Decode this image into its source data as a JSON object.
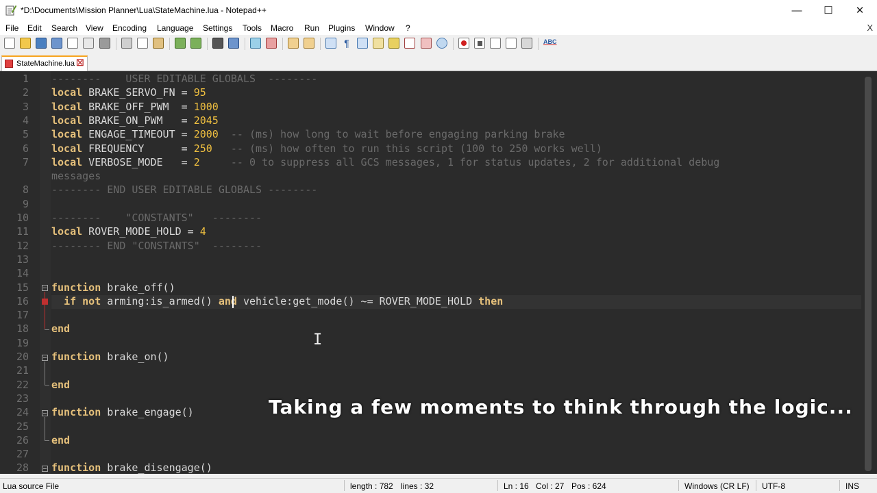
{
  "window": {
    "title": "*D:\\Documents\\Mission Planner\\Lua\\StateMachine.lua - Notepad++"
  },
  "window_controls": {
    "minimize": "—",
    "maximize": "☐",
    "close": "✕"
  },
  "menu": [
    "File",
    "Edit",
    "Search",
    "View",
    "Encoding",
    "Language",
    "Settings",
    "Tools",
    "Macro",
    "Run",
    "Plugins",
    "Window",
    "?"
  ],
  "menu_close": "X",
  "tab": {
    "label": "StateMachine.lua",
    "close": "☒"
  },
  "editor": {
    "line_numbers": [
      "1",
      "2",
      "3",
      "4",
      "5",
      "6",
      "7",
      "",
      "8",
      "9",
      "10",
      "11",
      "12",
      "13",
      "14",
      "15",
      "16",
      "17",
      "18",
      "19",
      "20",
      "21",
      "22",
      "23",
      "24",
      "25",
      "26",
      "27",
      "28"
    ],
    "lines": [
      {
        "cm": "--------    USER EDITABLE GLOBALS  --------"
      },
      {
        "kw": "local",
        "text": " BRAKE_SERVO_FN = ",
        "num": "95"
      },
      {
        "kw": "local",
        "text": " BRAKE_OFF_PWM  = ",
        "num": "1000"
      },
      {
        "kw": "local",
        "text": " BRAKE_ON_PWM   = ",
        "num": "2045"
      },
      {
        "kw": "local",
        "text": " ENGAGE_TIMEOUT = ",
        "num": "2000",
        "cm": "  -- (ms) how long to wait before engaging parking brake"
      },
      {
        "kw": "local",
        "text": " FREQUENCY      = ",
        "num": "250",
        "cm": "   -- (ms) how often to run this script (100 to 250 works well)"
      },
      {
        "kw": "local",
        "text": " VERBOSE_MODE   = ",
        "num": "2",
        "cm": "     -- 0 to suppress all GCS messages, 1 for status updates, 2 for additional debug"
      },
      {
        "cm": "messages"
      },
      {
        "cm": "-------- END USER EDITABLE GLOBALS --------"
      },
      {
        "text": ""
      },
      {
        "cm": "--------    \"CONSTANTS\"   --------"
      },
      {
        "kw": "local",
        "text": " ROVER_MODE_HOLD = ",
        "num": "4"
      },
      {
        "cm": "-------- END \"CONSTANTS\"  --------"
      },
      {
        "text": ""
      },
      {
        "text": ""
      },
      {
        "kw": "function",
        "text": " brake_off()"
      },
      {
        "pre": "  ",
        "kw": "if not",
        "text": " arming:is_armed() ",
        "kw2": "and",
        "text2": " vehicle:get_mode() ~= ROVER_MODE_HOLD ",
        "kw3": "then"
      },
      {
        "text": ""
      },
      {
        "kw": "end"
      },
      {
        "text": ""
      },
      {
        "kw": "function",
        "text": " brake_on()"
      },
      {
        "text": ""
      },
      {
        "kw": "end"
      },
      {
        "text": ""
      },
      {
        "kw": "function",
        "text": " brake_engage()"
      },
      {
        "text": ""
      },
      {
        "kw": "end"
      },
      {
        "text": ""
      },
      {
        "kw": "function",
        "text": " brake_disengage()"
      }
    ]
  },
  "overlay_caption": "Taking a few moments to think through the logic...",
  "status": {
    "file_type": "Lua source File",
    "length": "length : 782",
    "lines": "lines : 32",
    "ln": "Ln : 16",
    "col": "Col : 27",
    "pos": "Pos : 624",
    "eol": "Windows (CR LF)",
    "encoding": "UTF-8",
    "mode": "INS"
  }
}
